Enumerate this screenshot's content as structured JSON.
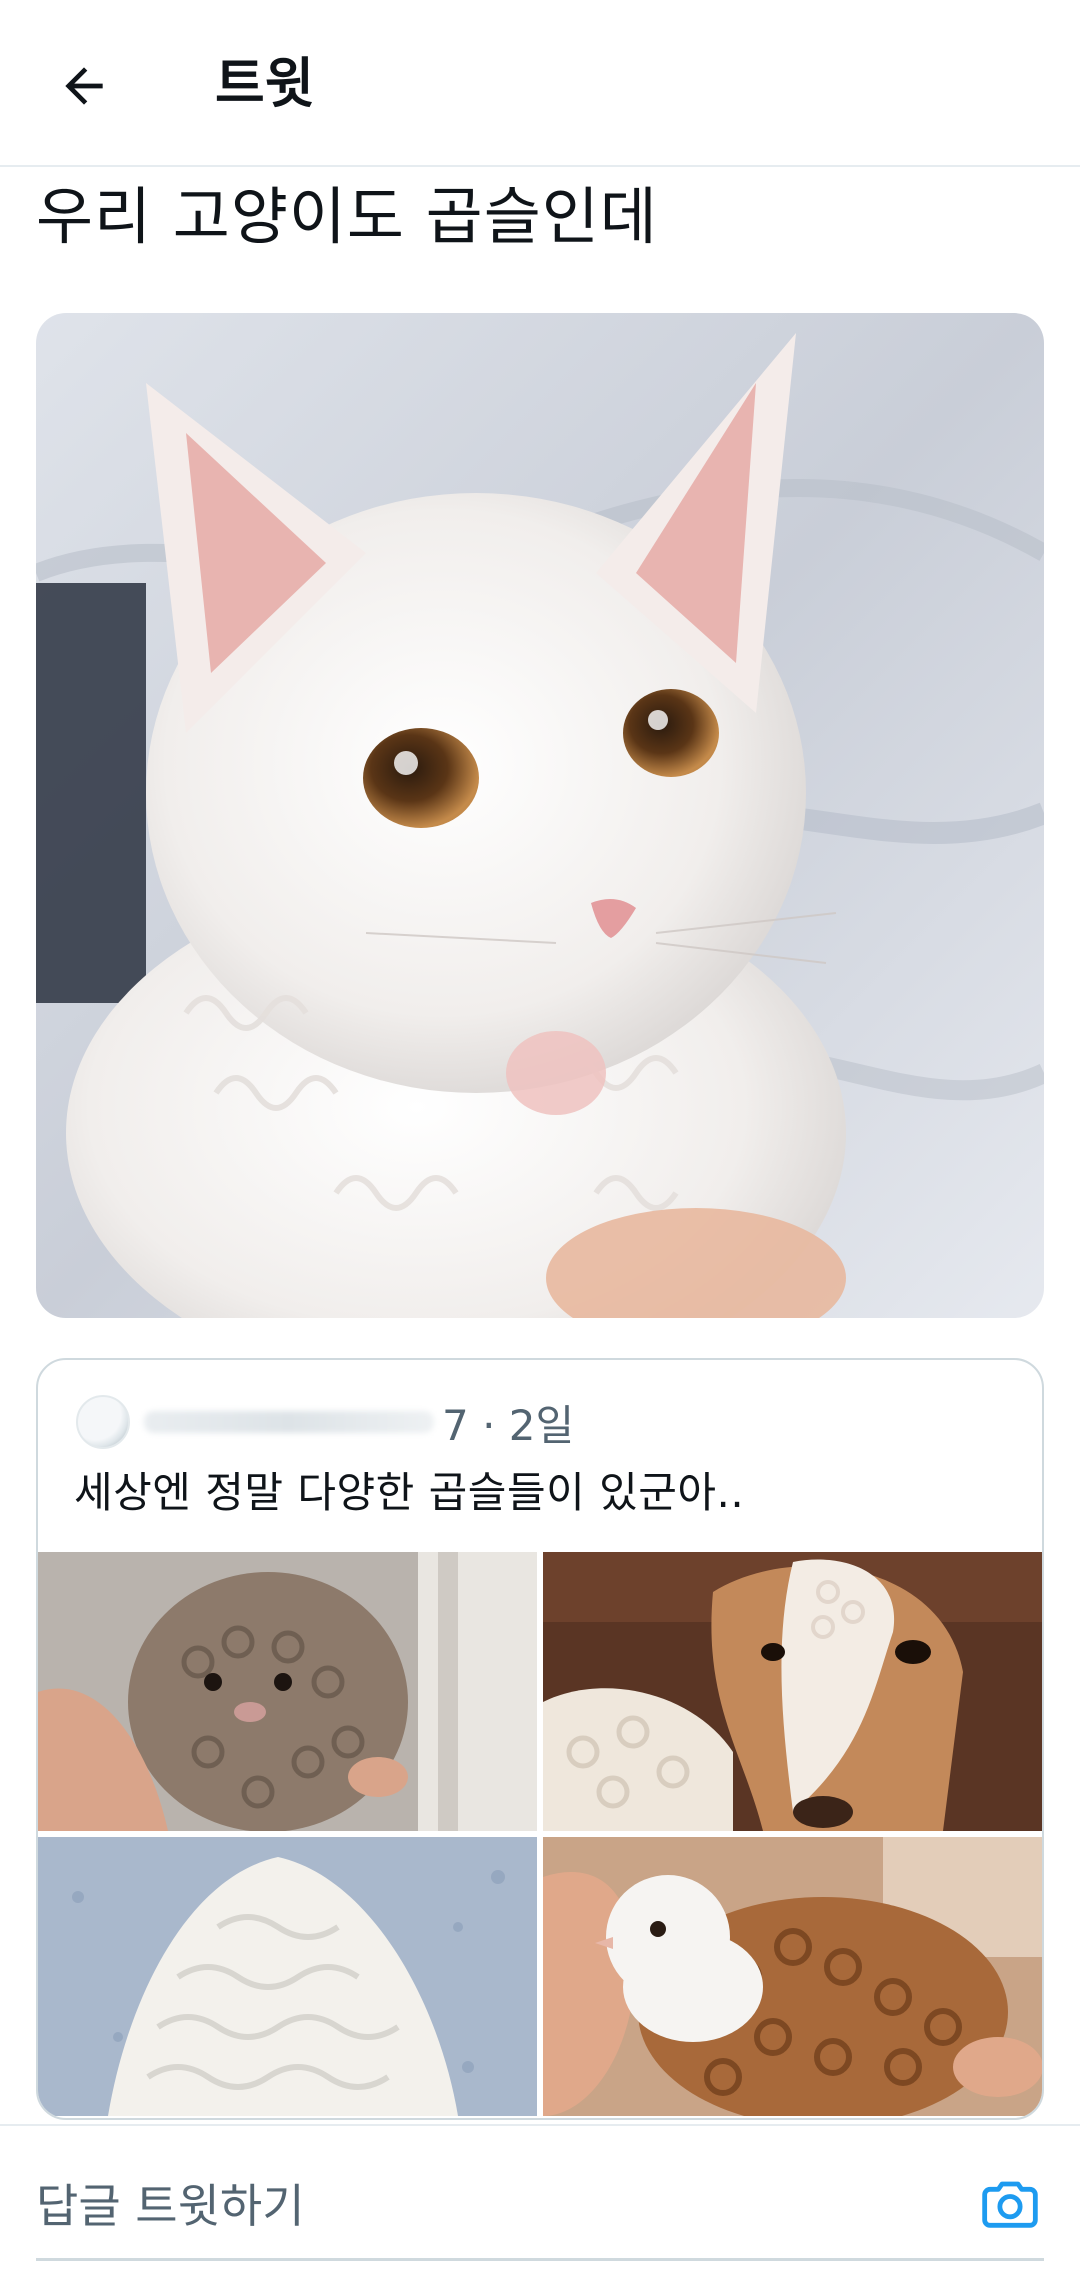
{
  "header": {
    "back_icon": "arrow-left-icon",
    "title": "트윗"
  },
  "tweet": {
    "text": "우리 고양이도 곱슬인데",
    "photo": "curly-white-cat-photo"
  },
  "quote": {
    "time": "7 · 2일",
    "text": "세상엔 정말 다양한 곱슬들이 있군아..",
    "photos": [
      "curly-rodent-photo",
      "curly-horse-photo",
      "curly-white-bird-photo",
      "curly-pigeon-photo"
    ]
  },
  "reply": {
    "placeholder": "답글 트윗하기",
    "camera_icon": "camera-icon"
  },
  "colors": {
    "accent": "#1d9bf0",
    "text": "#0f1419",
    "secondary": "#536471",
    "border": "#cfd9de"
  }
}
